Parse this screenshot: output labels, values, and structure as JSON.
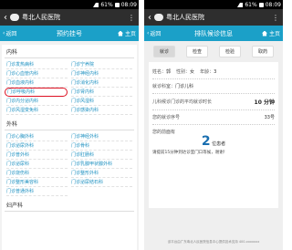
{
  "left": {
    "status": {
      "time": "08:09",
      "battery": "61%"
    },
    "wechat": {
      "title": "粤北人民医院"
    },
    "nav": {
      "back": "返回",
      "title": "预约挂号",
      "home": "主页"
    },
    "departments": [
      {
        "name": "内科",
        "clinics": [
          "门诊发热病科",
          "门诊宁养院",
          "门诊心血管内科",
          "门诊神经内科",
          "门诊血液内科",
          "门诊消化内科",
          "门诊呼吸内科",
          "门诊肾内科",
          "门诊内分泌内科",
          "门诊风湿科",
          "门诊风湿变免科",
          "门诊感染内科"
        ]
      },
      {
        "name": "外科",
        "clinics": [
          "门诊心胸外科",
          "门诊神经外科",
          "门诊泌尿外科",
          "门诊骨科",
          "门诊普外科",
          "门诊肛肠科",
          "门诊泌尿科",
          "门诊乳腺甲状腺外科",
          "门诊烧伤科",
          "门诊整形外科",
          "门诊整形美容科",
          "门诊泌尿结石科",
          "门诊普通外科"
        ]
      },
      {
        "name": "妇产科",
        "clinics": []
      }
    ],
    "selected_clinic": "门诊呼吸内科"
  },
  "right": {
    "status": {
      "time": "08:09",
      "battery": "61%"
    },
    "wechat": {
      "title": "粤北人民医院"
    },
    "nav": {
      "back": "返回",
      "title": "排队候诊信息",
      "home": "主页"
    },
    "tabs": [
      "就诊",
      "检查",
      "检验",
      "取药"
    ],
    "active_tab": "就诊",
    "patient": {
      "name_label": "姓名：",
      "name": "郭",
      "gender_label": "性别：",
      "gender": "女",
      "age_label": "年龄：",
      "age": "3"
    },
    "clinic_label": "就诊科室：",
    "clinic": "门诊儿科",
    "avg_label": "儿科候诊门诊的平均就诊时长",
    "avg_value": "10 分钟",
    "seq_label": "您的就诊序号",
    "seq_value": "33号",
    "ahead_label": "您的前面有",
    "ahead_count": "2",
    "ahead_unit": "位患者",
    "note": "请提前15分钟到达诊室门口等候，谢谢！",
    "footer": "该平台由广东粤北人民医院信息中心提供技术支持 400-xxxxxxx"
  }
}
